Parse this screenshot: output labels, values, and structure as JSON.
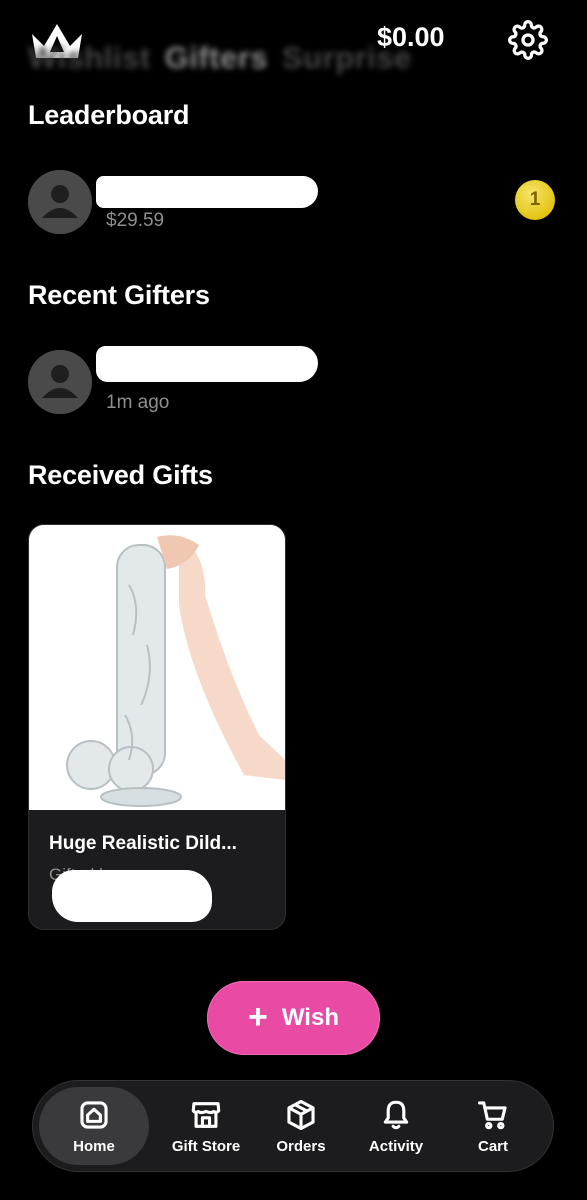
{
  "header": {
    "tabs": [
      "Wishlist",
      "Gifters",
      "Surprise"
    ],
    "active_tab": "Gifters",
    "balance": "$0.00"
  },
  "leaderboard": {
    "title": "Leaderboard",
    "entries": [
      {
        "amount": "$29.59",
        "rank": "1"
      }
    ]
  },
  "recent_gifters": {
    "title": "Recent Gifters",
    "entries": [
      {
        "time": "1m ago"
      }
    ]
  },
  "received_gifts": {
    "title": "Received Gifts",
    "items": [
      {
        "title": "Huge Realistic Dild...",
        "gifted_by": "Gifted b"
      }
    ]
  },
  "wish_button": {
    "label": "Wish"
  },
  "nav": {
    "items": [
      {
        "label": "Home",
        "icon": "home-icon"
      },
      {
        "label": "Gift Store",
        "icon": "store-icon"
      },
      {
        "label": "Orders",
        "icon": "package-icon"
      },
      {
        "label": "Activity",
        "icon": "bell-icon"
      },
      {
        "label": "Cart",
        "icon": "cart-icon"
      }
    ],
    "active": "Home"
  },
  "colors": {
    "background": "#000000",
    "accent_pink": "#e94aa4",
    "rank_gold": "#e4c413",
    "muted_text": "#8e8e8e",
    "nav_bg": "#1c1c1e"
  }
}
